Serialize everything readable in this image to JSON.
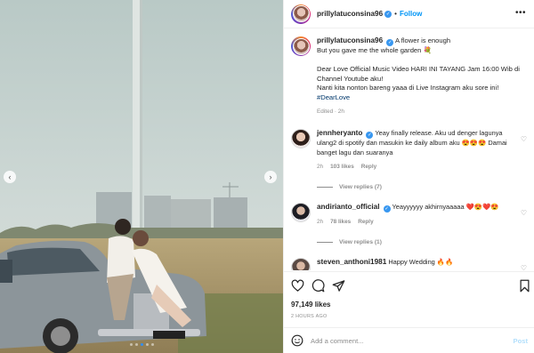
{
  "post": {
    "username": "prillylatuconsina96",
    "follow_label": "Follow",
    "more_label": "•••",
    "caption_lines": [
      "A flower is enough",
      "But you gave me the whole garden 💐",
      "",
      "Dear Love Official Music Video HARI INI TAYANG Jam 16:00 Wib di Channel Youtube aku!",
      "Nanti kita nonton bareng yaaa di Live Instagram aku sore ini!"
    ],
    "hashtag": "#DearLove",
    "caption_meta": "Edited · 2h",
    "likes": "97,149 likes",
    "time": "2 HOURS AGO"
  },
  "comments": [
    {
      "username": "jennheryanto",
      "text": "Yeay finally release. Aku ud denger lagunya ulang2 di spotify dan masukin ke daily album aku 😍😍😍 Damai banget lagu dan suaranya",
      "time": "2h",
      "likes": "103 likes",
      "reply": "Reply",
      "view_replies": "View replies (7)"
    },
    {
      "username": "andirianto_official",
      "text": "Yeayyyyyy akhirnyaaaaa ❤️😍❤️😍",
      "time": "2h",
      "likes": "78 likes",
      "reply": "Reply",
      "view_replies": "View replies (1)"
    },
    {
      "username": "steven_anthoni1981",
      "text": "Happy Wedding 🔥🔥"
    }
  ],
  "add_comment": {
    "placeholder": "Add a comment...",
    "post_label": "Post"
  },
  "carousel": {
    "prev": "‹",
    "next": "›",
    "slides": 5,
    "active_slide": 3
  },
  "icons": [
    "chevron-left-icon",
    "chevron-right-icon",
    "more-icon",
    "verified-icon",
    "heart-icon",
    "comment-icon",
    "share-icon",
    "bookmark-icon",
    "emoji-icon"
  ],
  "colors": {
    "accent": "#0095f6",
    "verified": "#3897f0",
    "hashtag": "#00376b",
    "muted": "#8e8e8e",
    "post_disabled": "#b2dffc"
  }
}
